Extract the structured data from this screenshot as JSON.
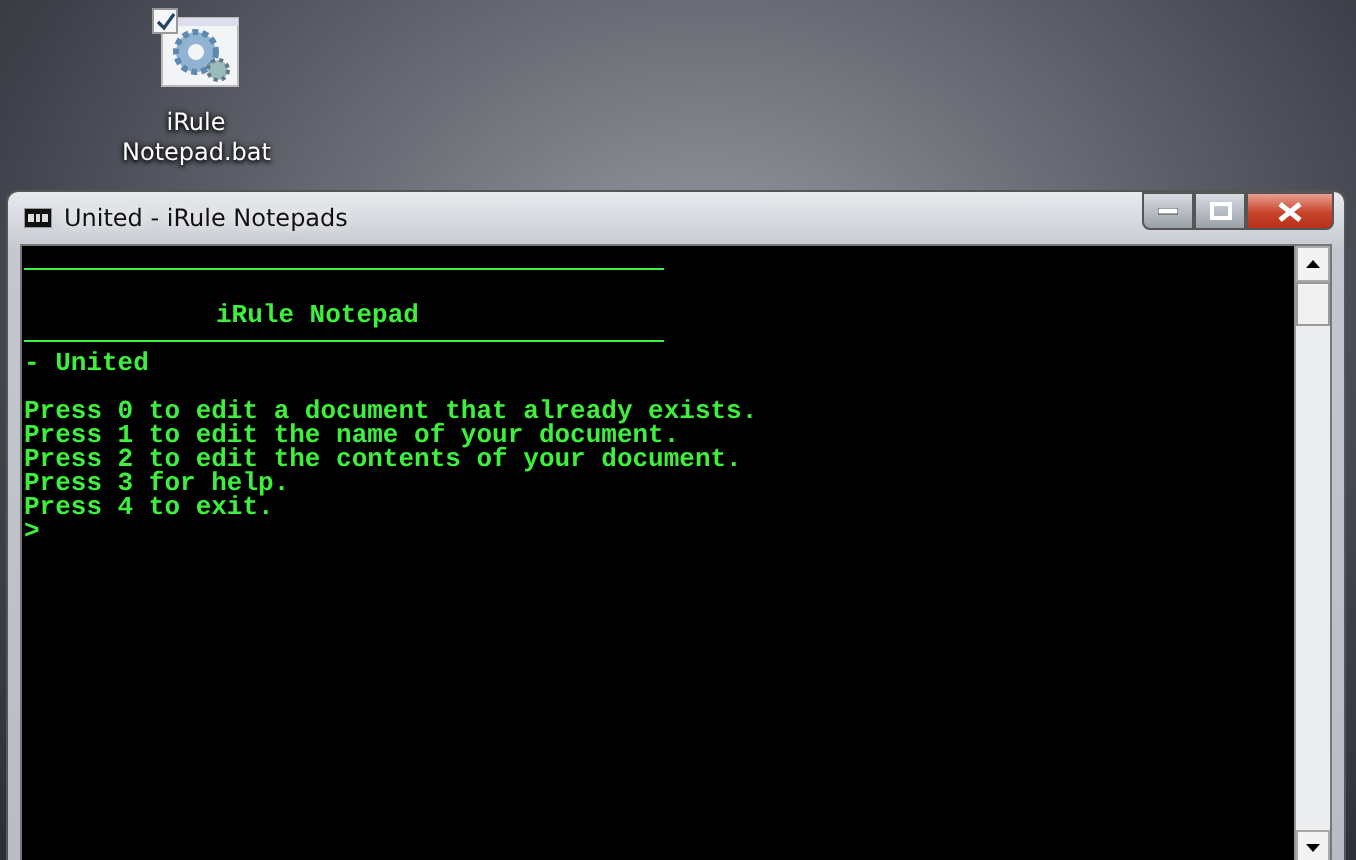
{
  "desktop_icons": [
    {
      "label": "iRule Notepad.bat",
      "checked": true
    }
  ],
  "window": {
    "title": "United - iRule Notepads"
  },
  "console": {
    "heading": "iRule Notepad",
    "document": "- United",
    "lines": [
      "Press 0 to edit a document that already exists.",
      "Press 1 to edit the name of your document.",
      "Press 2 to edit the contents of your document.",
      "Press 3 for help.",
      "Press 4 to exit."
    ],
    "prompt": ">"
  }
}
